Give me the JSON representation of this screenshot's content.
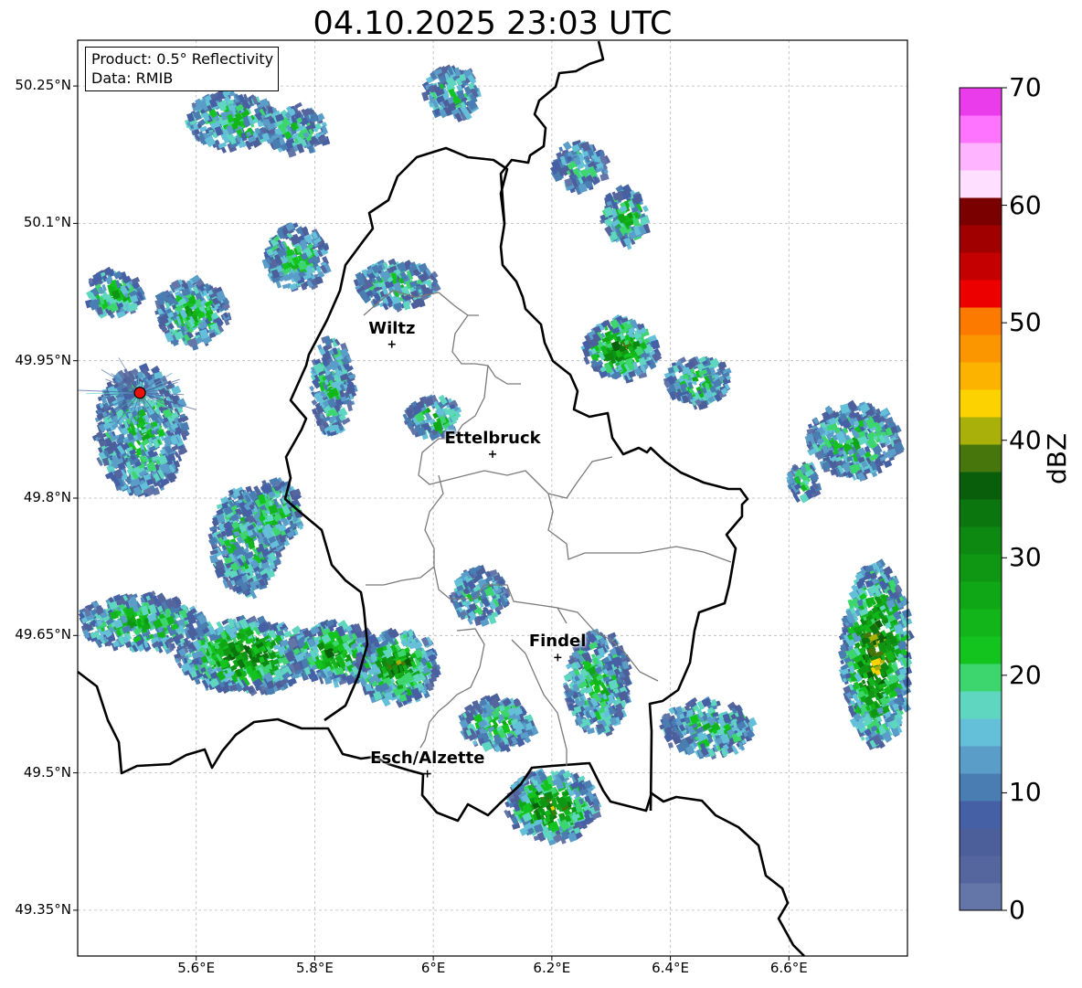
{
  "title": "04.10.2025 23:03 UTC",
  "info": {
    "product": "Product: 0.5° Reflectivity",
    "source": "Data: RMIB"
  },
  "axes": {
    "lon_ticks": [
      "5.6°E",
      "5.8°E",
      "6°E",
      "6.2°E",
      "6.4°E",
      "6.6°E"
    ],
    "lat_ticks": [
      "50.25°N",
      "50.1°N",
      "49.95°N",
      "49.8°N",
      "49.65°N",
      "49.5°N",
      "49.35°N"
    ],
    "lon_range": [
      5.4,
      6.8
    ],
    "lat_range": [
      49.3,
      50.3
    ]
  },
  "cities": [
    {
      "name": "Wiltz",
      "lon": 5.93,
      "lat": 49.968
    },
    {
      "name": "Ettelbruck",
      "lon": 6.1,
      "lat": 49.848
    },
    {
      "name": "Findel",
      "lon": 6.21,
      "lat": 49.626
    },
    {
      "name": "Esch/Alzette",
      "lon": 5.99,
      "lat": 49.499
    }
  ],
  "radar_site": {
    "lon": 5.505,
    "lat": 49.915,
    "color": "#e8120c"
  },
  "colorbar": {
    "label": "dBZ",
    "tick_labels": [
      "0",
      "10",
      "20",
      "30",
      "40",
      "50",
      "60",
      "70"
    ],
    "min": 0,
    "max": 70,
    "step": 2.5,
    "colors": [
      "#6475a7",
      "#55669e",
      "#4c5f9a",
      "#4560a4",
      "#4a7db2",
      "#5a9dc8",
      "#64c0d8",
      "#5fd6c0",
      "#3dd56d",
      "#13c41f",
      "#12b51a",
      "#10a716",
      "#0f9714",
      "#0d8811",
      "#0b760e",
      "#095e0b",
      "#47760c",
      "#a9b00a",
      "#fcd300",
      "#fbb300",
      "#fb9600",
      "#fc7a00",
      "#ed0000",
      "#c40000",
      "#a10000",
      "#7a0000",
      "#ffdfff",
      "#ffb4ff",
      "#ff74ff",
      "#ea3cea"
    ]
  }
}
